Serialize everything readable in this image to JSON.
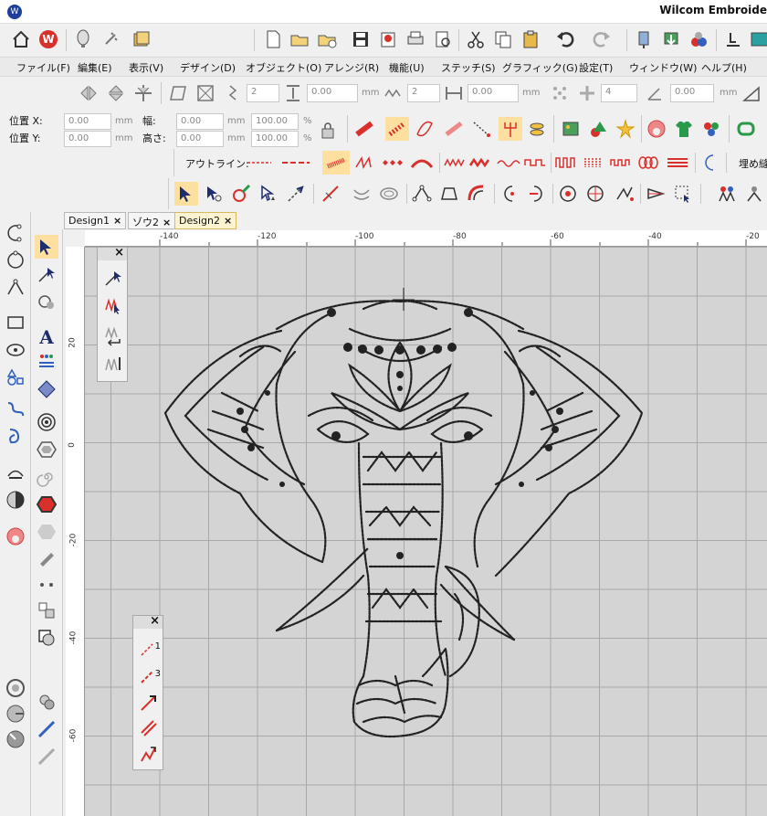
{
  "app": {
    "title": "Wilcom Embroide"
  },
  "menu": [
    "ファイル(F)",
    "編集(E)",
    "表示(V)",
    "デザイン(D)",
    "オブジェクト(O)",
    "アレンジ(R)",
    "機能(U)",
    "ステッチ(S)",
    "グラフィック(G)",
    "設定(T)",
    "ウィンドウ(W)",
    "ヘルプ(H)"
  ],
  "property_bar": {
    "spin1": "2",
    "spin2": "0.00",
    "unit_mm": "mm",
    "spin3": "2",
    "spin4": "0.00",
    "spin5": "4",
    "spin6": "0.00"
  },
  "position": {
    "x_label": "位置 X:",
    "y_label": "位置 Y:",
    "x_value": "0.00",
    "y_value": "0.00",
    "width_label": "幅:",
    "height_label": "高さ:",
    "width_value": "0.00",
    "height_value": "0.00",
    "width_pct": "100.00",
    "height_pct": "100.00",
    "unit": "mm",
    "pct": "%"
  },
  "outline_label": "アウトライン:",
  "fill_label": "埋め縫",
  "tabs": [
    {
      "label": "Design1",
      "close": "×"
    },
    {
      "label": "ゾウ2",
      "close": "×"
    },
    {
      "label": "Design2",
      "close": "×"
    }
  ],
  "ruler_top": [
    "-140",
    "-120",
    "-100",
    "-80",
    "-60",
    "-40",
    "-20"
  ],
  "ruler_left": [
    "20",
    "0",
    "-20",
    "-40",
    "-60"
  ],
  "float_panel_1": {
    "close": "×"
  },
  "float_panel_2": {
    "close": "×",
    "label_1": "1",
    "label_3": "3"
  },
  "colors": {
    "accent_red": "#d9302c",
    "toolbar_bg": "#f0f0f0",
    "canvas_bg": "#d4d4d4",
    "tab_active": "#fdf3d0"
  }
}
